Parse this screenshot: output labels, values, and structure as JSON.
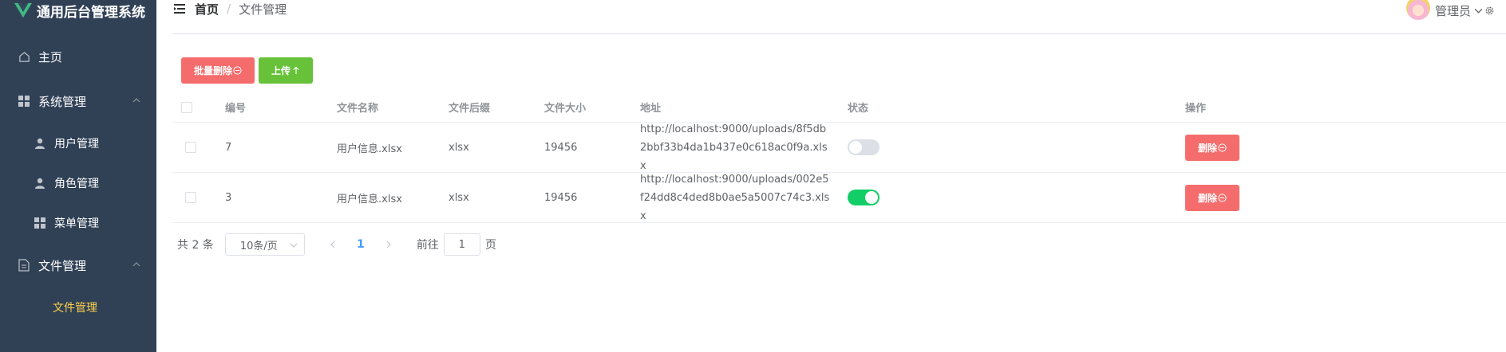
{
  "app": {
    "title": "通用后台管理系统"
  },
  "sidebar": {
    "items": [
      {
        "label": "主页"
      },
      {
        "label": "系统管理"
      },
      {
        "label": "用户管理"
      },
      {
        "label": "角色管理"
      },
      {
        "label": "菜单管理"
      },
      {
        "label": "文件管理"
      },
      {
        "label": "文件管理"
      }
    ],
    "active_color": "#ffd04b",
    "bg_color": "#304156"
  },
  "header": {
    "breadcrumb": {
      "home": "首页",
      "separator": "/",
      "current": "文件管理"
    },
    "user": {
      "name": "管理员"
    }
  },
  "toolbar": {
    "batch_delete_label": "批量删除",
    "upload_label": "上传"
  },
  "table": {
    "columns": [
      "编号",
      "文件名称",
      "文件后缀",
      "文件大小",
      "地址",
      "状态",
      "操作"
    ],
    "rows": [
      {
        "id": "7",
        "name": "用户信息.xlsx",
        "ext": "xlsx",
        "size": "19456",
        "url": "http://localhost:9000/uploads/8f5db2bbf33b4da1b437e0c618ac0f9a.xlsx",
        "enabled": false,
        "action": "删除"
      },
      {
        "id": "3",
        "name": "用户信息.xlsx",
        "ext": "xlsx",
        "size": "19456",
        "url": "http://localhost:9000/uploads/002e5f24dd8c4ded8b0ae5a5007c74c3.xlsx",
        "enabled": true,
        "action": "删除"
      }
    ]
  },
  "pagination": {
    "total_text": "共 2 条",
    "page_size": "10条/页",
    "current_page": "1",
    "goto_prefix": "前往",
    "goto_value": "1",
    "goto_suffix": "页"
  },
  "colors": {
    "danger": "#f56c6c",
    "success": "#67c23a",
    "switch_on": "#13ce66",
    "primary": "#409eff"
  }
}
